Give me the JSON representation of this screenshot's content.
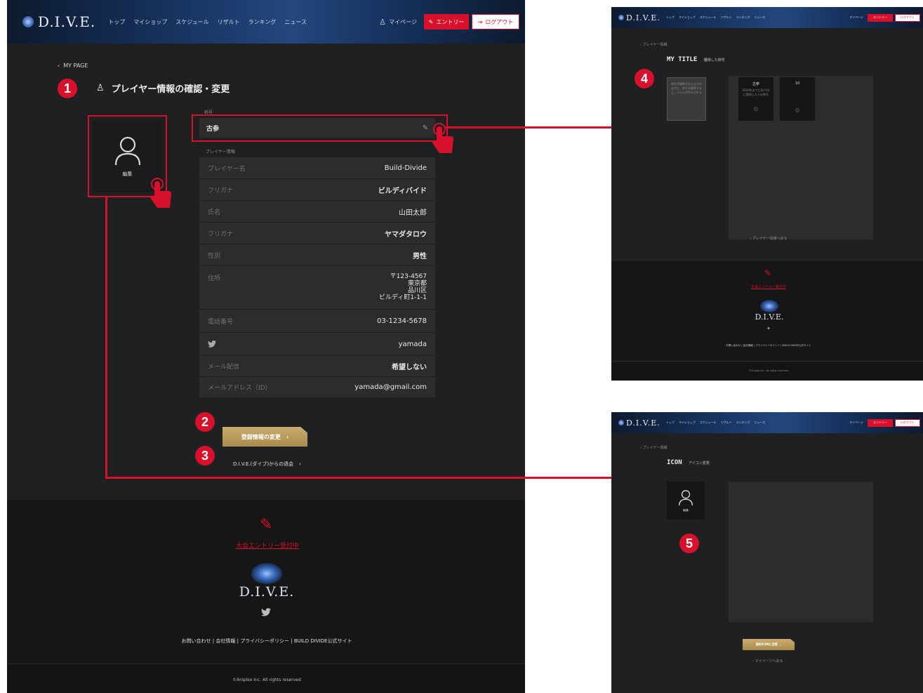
{
  "header": {
    "logo": "D.I.V.E.",
    "nav": [
      "トップ",
      "マイショップ",
      "スケジュール",
      "リザルト",
      "ランキング",
      "ニュース"
    ],
    "mypage": "マイページ",
    "entry": "エントリー",
    "logout": "ログアウト"
  },
  "main": {
    "back_link": "MY PAGE",
    "page_title": "プレイヤー情報の確認・変更",
    "avatar_edit": "編集",
    "title_label": "称号",
    "title_value": "古参",
    "player_info_label": "プレイヤー情報",
    "rows": [
      {
        "key": "プレイヤー名",
        "value": "Build-Divide"
      },
      {
        "key": "フリガナ",
        "value": "ビルディバイド"
      },
      {
        "key": "氏名",
        "value": "山田太郎"
      },
      {
        "key": "フリガナ",
        "value": "ヤマダタロウ"
      },
      {
        "key": "性別",
        "value": "男性"
      },
      {
        "key": "住所",
        "value": "〒123-4567\n東京都\n品川区\nビルディ町1-1-1"
      },
      {
        "key": "電話番号",
        "value": "03-1234-5678"
      },
      {
        "key": "twitter-icon",
        "value": "yamada"
      },
      {
        "key": "メール配信",
        "value": "希望しない"
      },
      {
        "key": "メールアドレス（ID）",
        "value": "yamada@gmail.com"
      }
    ],
    "change_button": "登録情報の変更",
    "withdraw_link": "D.I.V.E.(ダイブ)からの退会"
  },
  "footer": {
    "entry_link": "大会エントリー受付中",
    "logo": "D.I.V.E.",
    "links": "お問い合わせ | 会社情報 | プライバシーポリシー | BUILD DIVIDE公式サイト",
    "copyright": "©Aniplex Inc. All rights reserved"
  },
  "annotations": [
    "1",
    "2",
    "3",
    "4",
    "5"
  ],
  "screen_title": {
    "back": "プレイヤー情報",
    "heading": "MY TITLE",
    "sub": "獲得した称号",
    "card1_text": "称号が獲得されたまでのなかに、称号を獲得すると、バッジが付与される",
    "card2_title": "古参",
    "card2_text": "2020年までにD.I.V.Eに登録した人の称号",
    "card3_title": "10",
    "back_bottom": "プレイヤー情報へ戻る",
    "footer_entry": "大会エントリー受付中",
    "footer_links": "お問い合わせ | 会社情報 | プライバシーポリシー | BUILD DIVIDE公式サイト",
    "copyright": "©Aniplex Inc. All rights reserved"
  },
  "screen_icon": {
    "back": "プレイヤー情報",
    "heading": "ICON",
    "sub": "アイコン変更",
    "edit": "編集",
    "button": "選択ICONに変更",
    "back_bottom": "マイページへ戻る"
  },
  "colors": {
    "accent": "#d8102b",
    "gold": "#b89a5a",
    "bg": "#1f2021"
  }
}
